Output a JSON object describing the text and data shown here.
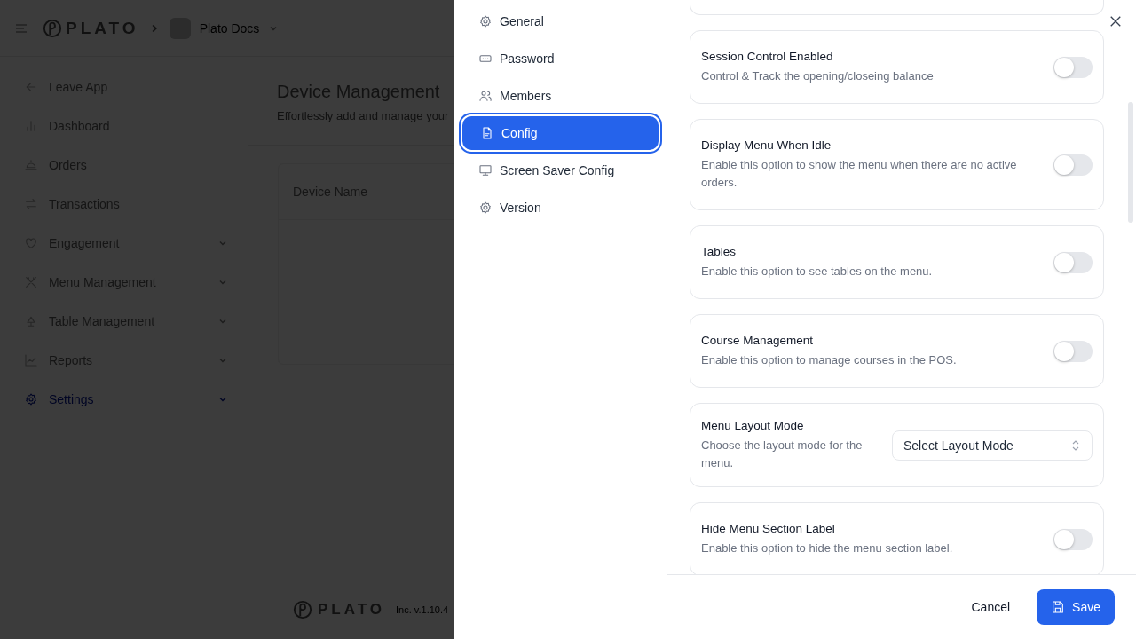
{
  "header": {
    "logo": "PLATO",
    "workspace": "Plato Docs"
  },
  "sidebar": {
    "items": [
      {
        "label": "Leave App",
        "kind": "link",
        "selected": false
      },
      {
        "label": "Dashboard",
        "kind": "link",
        "selected": false
      },
      {
        "label": "Orders",
        "kind": "link",
        "selected": false
      },
      {
        "label": "Transactions",
        "kind": "link",
        "selected": false
      },
      {
        "label": "Engagement",
        "kind": "group",
        "selected": false
      },
      {
        "label": "Menu Management",
        "kind": "group",
        "selected": false
      },
      {
        "label": "Table Management",
        "kind": "group",
        "selected": false
      },
      {
        "label": "Reports",
        "kind": "group",
        "selected": false
      },
      {
        "label": "Settings",
        "kind": "group",
        "selected": true
      }
    ]
  },
  "page": {
    "title": "Device Management",
    "subtitle": "Effortlessly add and manage your",
    "table": {
      "columns": [
        "Device Name"
      ]
    }
  },
  "footer": {
    "logo": "PLATO",
    "version": "Inc. v.1.10.4"
  },
  "dialog": {
    "nav": [
      {
        "label": "General",
        "selected": false
      },
      {
        "label": "Password",
        "selected": false
      },
      {
        "label": "Members",
        "selected": false
      },
      {
        "label": "Config",
        "selected": true
      },
      {
        "label": "Screen Saver Config",
        "selected": false
      },
      {
        "label": "Version",
        "selected": false
      }
    ],
    "settings": [
      {
        "kind": "toggle",
        "title": "Session Control Enabled",
        "description": "Control & Track the opening/closeing balance",
        "on": false
      },
      {
        "kind": "toggle",
        "title": "Display Menu When Idle",
        "description": "Enable this option to show the menu when there are no active orders.",
        "on": false
      },
      {
        "kind": "toggle",
        "title": "Tables",
        "description": "Enable this option to see tables on the menu.",
        "on": false
      },
      {
        "kind": "toggle",
        "title": "Course Management",
        "description": "Enable this option to manage courses in the POS.",
        "on": false
      },
      {
        "kind": "select",
        "title": "Menu Layout Mode",
        "description": "Choose the layout mode for the menu.",
        "placeholder": "Select Layout Mode"
      },
      {
        "kind": "toggle",
        "title": "Hide Menu Section Label",
        "description": "Enable this option to hide the menu section label.",
        "on": false
      }
    ],
    "cancel": "Cancel",
    "save": "Save"
  }
}
